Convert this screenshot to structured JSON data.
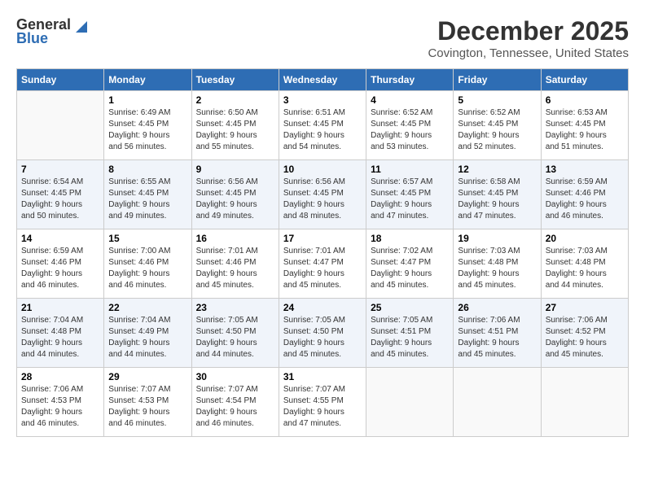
{
  "logo": {
    "general": "General",
    "blue": "Blue"
  },
  "title": "December 2025",
  "location": "Covington, Tennessee, United States",
  "headers": [
    "Sunday",
    "Monday",
    "Tuesday",
    "Wednesday",
    "Thursday",
    "Friday",
    "Saturday"
  ],
  "weeks": [
    [
      {
        "day": "",
        "info": ""
      },
      {
        "day": "1",
        "info": "Sunrise: 6:49 AM\nSunset: 4:45 PM\nDaylight: 9 hours\nand 56 minutes."
      },
      {
        "day": "2",
        "info": "Sunrise: 6:50 AM\nSunset: 4:45 PM\nDaylight: 9 hours\nand 55 minutes."
      },
      {
        "day": "3",
        "info": "Sunrise: 6:51 AM\nSunset: 4:45 PM\nDaylight: 9 hours\nand 54 minutes."
      },
      {
        "day": "4",
        "info": "Sunrise: 6:52 AM\nSunset: 4:45 PM\nDaylight: 9 hours\nand 53 minutes."
      },
      {
        "day": "5",
        "info": "Sunrise: 6:52 AM\nSunset: 4:45 PM\nDaylight: 9 hours\nand 52 minutes."
      },
      {
        "day": "6",
        "info": "Sunrise: 6:53 AM\nSunset: 4:45 PM\nDaylight: 9 hours\nand 51 minutes."
      }
    ],
    [
      {
        "day": "7",
        "info": "Sunrise: 6:54 AM\nSunset: 4:45 PM\nDaylight: 9 hours\nand 50 minutes."
      },
      {
        "day": "8",
        "info": "Sunrise: 6:55 AM\nSunset: 4:45 PM\nDaylight: 9 hours\nand 49 minutes."
      },
      {
        "day": "9",
        "info": "Sunrise: 6:56 AM\nSunset: 4:45 PM\nDaylight: 9 hours\nand 49 minutes."
      },
      {
        "day": "10",
        "info": "Sunrise: 6:56 AM\nSunset: 4:45 PM\nDaylight: 9 hours\nand 48 minutes."
      },
      {
        "day": "11",
        "info": "Sunrise: 6:57 AM\nSunset: 4:45 PM\nDaylight: 9 hours\nand 47 minutes."
      },
      {
        "day": "12",
        "info": "Sunrise: 6:58 AM\nSunset: 4:45 PM\nDaylight: 9 hours\nand 47 minutes."
      },
      {
        "day": "13",
        "info": "Sunrise: 6:59 AM\nSunset: 4:46 PM\nDaylight: 9 hours\nand 46 minutes."
      }
    ],
    [
      {
        "day": "14",
        "info": "Sunrise: 6:59 AM\nSunset: 4:46 PM\nDaylight: 9 hours\nand 46 minutes."
      },
      {
        "day": "15",
        "info": "Sunrise: 7:00 AM\nSunset: 4:46 PM\nDaylight: 9 hours\nand 46 minutes."
      },
      {
        "day": "16",
        "info": "Sunrise: 7:01 AM\nSunset: 4:46 PM\nDaylight: 9 hours\nand 45 minutes."
      },
      {
        "day": "17",
        "info": "Sunrise: 7:01 AM\nSunset: 4:47 PM\nDaylight: 9 hours\nand 45 minutes."
      },
      {
        "day": "18",
        "info": "Sunrise: 7:02 AM\nSunset: 4:47 PM\nDaylight: 9 hours\nand 45 minutes."
      },
      {
        "day": "19",
        "info": "Sunrise: 7:03 AM\nSunset: 4:48 PM\nDaylight: 9 hours\nand 45 minutes."
      },
      {
        "day": "20",
        "info": "Sunrise: 7:03 AM\nSunset: 4:48 PM\nDaylight: 9 hours\nand 44 minutes."
      }
    ],
    [
      {
        "day": "21",
        "info": "Sunrise: 7:04 AM\nSunset: 4:48 PM\nDaylight: 9 hours\nand 44 minutes."
      },
      {
        "day": "22",
        "info": "Sunrise: 7:04 AM\nSunset: 4:49 PM\nDaylight: 9 hours\nand 44 minutes."
      },
      {
        "day": "23",
        "info": "Sunrise: 7:05 AM\nSunset: 4:50 PM\nDaylight: 9 hours\nand 44 minutes."
      },
      {
        "day": "24",
        "info": "Sunrise: 7:05 AM\nSunset: 4:50 PM\nDaylight: 9 hours\nand 45 minutes."
      },
      {
        "day": "25",
        "info": "Sunrise: 7:05 AM\nSunset: 4:51 PM\nDaylight: 9 hours\nand 45 minutes."
      },
      {
        "day": "26",
        "info": "Sunrise: 7:06 AM\nSunset: 4:51 PM\nDaylight: 9 hours\nand 45 minutes."
      },
      {
        "day": "27",
        "info": "Sunrise: 7:06 AM\nSunset: 4:52 PM\nDaylight: 9 hours\nand 45 minutes."
      }
    ],
    [
      {
        "day": "28",
        "info": "Sunrise: 7:06 AM\nSunset: 4:53 PM\nDaylight: 9 hours\nand 46 minutes."
      },
      {
        "day": "29",
        "info": "Sunrise: 7:07 AM\nSunset: 4:53 PM\nDaylight: 9 hours\nand 46 minutes."
      },
      {
        "day": "30",
        "info": "Sunrise: 7:07 AM\nSunset: 4:54 PM\nDaylight: 9 hours\nand 46 minutes."
      },
      {
        "day": "31",
        "info": "Sunrise: 7:07 AM\nSunset: 4:55 PM\nDaylight: 9 hours\nand 47 minutes."
      },
      {
        "day": "",
        "info": ""
      },
      {
        "day": "",
        "info": ""
      },
      {
        "day": "",
        "info": ""
      }
    ]
  ]
}
